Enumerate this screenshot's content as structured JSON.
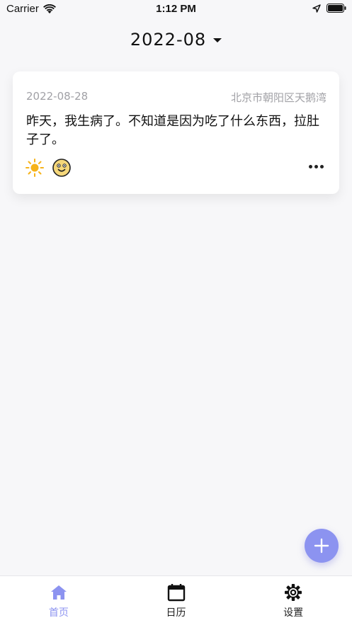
{
  "status_bar": {
    "carrier": "Carrier",
    "time": "1:12 PM"
  },
  "header": {
    "month": "2022-08"
  },
  "entries": [
    {
      "date": "2022-08-28",
      "location": "北京市朝阳区天鹅湾",
      "text": "昨天，我生病了。不知道是因为吃了什么东西，拉肚子了。",
      "weather_icon": "sun-icon",
      "mood_icon": "smiley-icon"
    }
  ],
  "tabs": [
    {
      "label": "首页",
      "icon": "home-icon",
      "active": true
    },
    {
      "label": "日历",
      "icon": "calendar-icon",
      "active": false
    },
    {
      "label": "设置",
      "icon": "gear-icon",
      "active": false
    }
  ],
  "colors": {
    "accent": "#8c93f0",
    "background": "#f7f7f9",
    "muted_text": "#a1a1a6",
    "sun": "#f6b31a",
    "mood_face": "#f5d77a"
  }
}
